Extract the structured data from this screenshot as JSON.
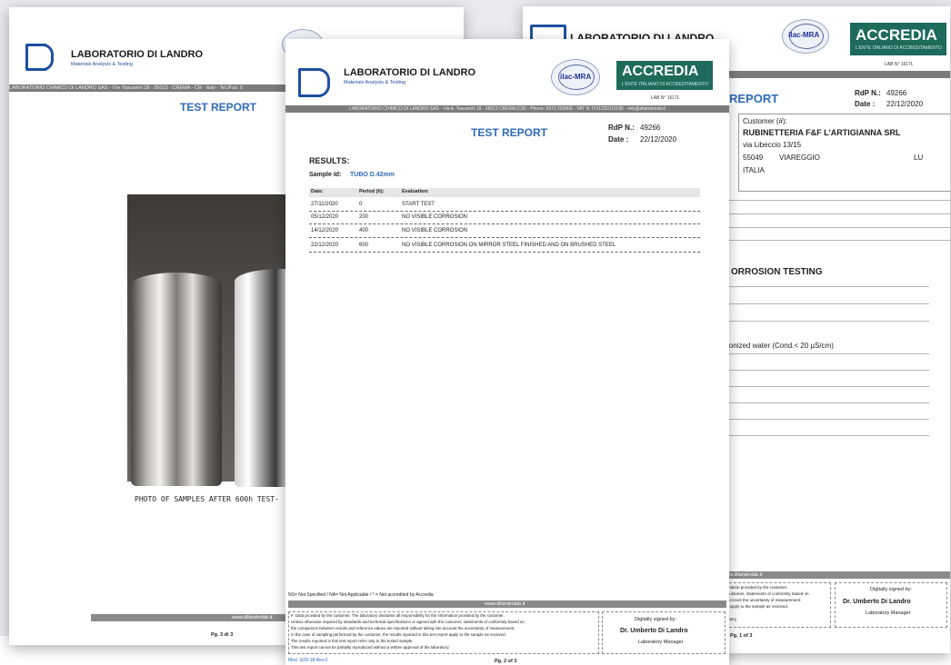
{
  "lab": {
    "name": "LABORATORIO DI LANDRO",
    "subtitle": "Materials Analysis & Testing",
    "logo_text": "DL",
    "address_bar_left": "LABORATORIO CHIMICO DI LANDRO SAS - V.le Toscanini 18 - 26013 - CREMA - CR - Italy - Tel./Fax: 0",
    "address_bar_mid": "LABORATORIO CHIMICO DI LANDRO SAS - Via A. Toscanini 18 - 26013 CREMA (CR) - Phone: 0373 202906 - VAT N. IT01231610195 - info@dilandrolab.it",
    "address_bar_right": "REMA (CR) - Phone: 0373 202906 - VAT N. IT01231610195 - info@dilandrolab.it",
    "iso_badge": "ilac-MRA",
    "accredia": "ACCREDIA",
    "accredia_sub": "L'ENTE ITALIANO DI ACCREDITAMENTO",
    "lab_number": "LAB N° 1617L",
    "website": "www.dilandrolab.it"
  },
  "page_left": {
    "title": "TEST REPORT",
    "photo_caption": "PHOTO OF SAMPLES AFTER 600h TEST-",
    "page_number": "Pg. 3 di 3"
  },
  "page_mid": {
    "title": "TEST REPORT",
    "rdp_label": "RdP N.:",
    "rdp_value": "49266",
    "date_label": "Date :",
    "date_value": "22/12/2020",
    "results_heading": "RESULTS:",
    "sample_label": "Sample Id:",
    "sample_value": "TUBO D.42mm",
    "table": {
      "headers": [
        "Date:",
        "Period (h):",
        "Evaluation:"
      ],
      "rows": [
        [
          "27/11/2020",
          "0",
          "START TEST"
        ],
        [
          "05/12/2020",
          "200",
          "NO VISIBLE CORROSION"
        ],
        [
          "14/12/2020",
          "400",
          "NO VISIBLE CORROSION"
        ],
        [
          "22/12/2020",
          "600",
          "NO VISIBLE CORROSION ON MIRROR STEEL FINISHED AND ON BRUSHED STEEL"
        ]
      ]
    },
    "notes": "NS= Not Specified / NA= Not Applicable / * = Not accredited by Accredia",
    "disclaimer": [
      "#: Data provided by the customer. The laboratory disclaims all responsibility for the information provided by the customer.",
      "Unless otherwise required by standards and technical specifications or agreed with the customer, statements of conformity based on",
      "the comparison between results and reference values are reported without taking into account the uncertainty of measurement.",
      "In the case of sampling performed by the customer, the results reported in this test report apply to the sample as received.",
      "The results reported in this test report refer only to the tested sample.",
      "This test report cannot be partially reproduced without a written approval of the laboratory."
    ],
    "signed_label": "Digitally signed by:",
    "signer": "Dr. Umberto Di Landro",
    "signer_role": "Laboratory Manager",
    "mod": "Mod. G09-18 Rev.0",
    "page_number": "Pg. 2 of 3"
  },
  "page_right": {
    "title_partial": "REPORT",
    "rdp_label": "RdP N.:",
    "rdp_value": "49266",
    "date_label": "Date :",
    "date_value": "22/12/2020",
    "customer_label": "Customer (#):",
    "customer_name": "RUBINETTERIA F&F L'ARTIGIANNA SRL",
    "customer_street": "via Libeccio 13/15",
    "customer_zip": "55049",
    "customer_city": "VIAREGGIO",
    "customer_prov": "LU",
    "customer_country": "ITALIA",
    "section_title": "ORROSION TESTING",
    "water_text": "ionized water (Cond.< 20 µS/cm)",
    "disclaimer_partial": [
      "mation provided by the customer.",
      "customer, statements of conformity based on",
      "account the uncertainty of measurement.",
      "t apply to the sample as received.",
      "",
      "atory."
    ],
    "signed_label": "Digitally signed by:",
    "signer": "Dr. Umberto Di Landro",
    "signer_role": "Laboratory Manager",
    "page_number": "Pg. 1 of 3",
    "website_partial": "w.dilandrolab.it"
  }
}
